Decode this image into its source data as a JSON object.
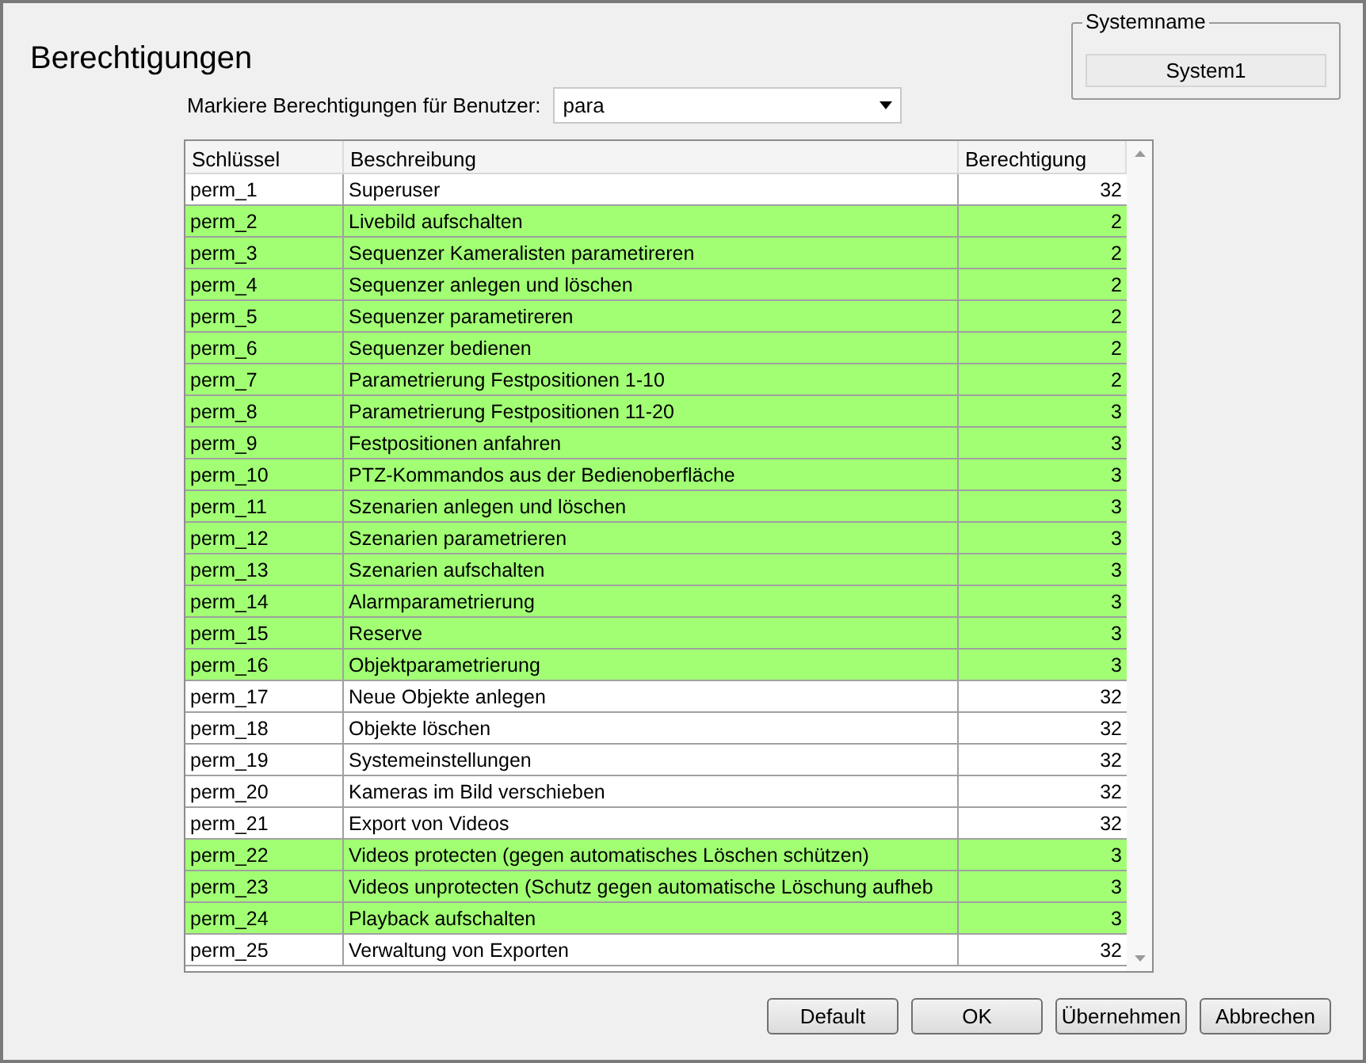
{
  "title": "Berechtigungen",
  "systemname": {
    "legend": "Systemname",
    "value": "System1"
  },
  "user_select": {
    "label": "Markiere Berechtigungen für Benutzer:",
    "value": "para"
  },
  "table": {
    "columns": [
      "Schlüssel",
      "Beschreibung",
      "Berechtigung"
    ],
    "rows": [
      {
        "key": "perm_1",
        "description": "Superuser",
        "permission": "32",
        "marked": false
      },
      {
        "key": "perm_2",
        "description": "Livebild aufschalten",
        "permission": "2",
        "marked": true
      },
      {
        "key": "perm_3",
        "description": "Sequenzer Kameralisten parametireren",
        "permission": "2",
        "marked": true
      },
      {
        "key": "perm_4",
        "description": "Sequenzer anlegen und löschen",
        "permission": "2",
        "marked": true
      },
      {
        "key": "perm_5",
        "description": "Sequenzer parametireren",
        "permission": "2",
        "marked": true
      },
      {
        "key": "perm_6",
        "description": "Sequenzer bedienen",
        "permission": "2",
        "marked": true
      },
      {
        "key": "perm_7",
        "description": "Parametrierung Festpositionen 1-10",
        "permission": "2",
        "marked": true
      },
      {
        "key": "perm_8",
        "description": "Parametrierung Festpositionen 11-20",
        "permission": "3",
        "marked": true
      },
      {
        "key": "perm_9",
        "description": "Festpositionen anfahren",
        "permission": "3",
        "marked": true
      },
      {
        "key": "perm_10",
        "description": "PTZ-Kommandos aus der Bedienoberfläche",
        "permission": "3",
        "marked": true
      },
      {
        "key": "perm_11",
        "description": "Szenarien anlegen und löschen",
        "permission": "3",
        "marked": true
      },
      {
        "key": "perm_12",
        "description": "Szenarien parametrieren",
        "permission": "3",
        "marked": true
      },
      {
        "key": "perm_13",
        "description": "Szenarien aufschalten",
        "permission": "3",
        "marked": true
      },
      {
        "key": "perm_14",
        "description": "Alarmparametrierung",
        "permission": "3",
        "marked": true
      },
      {
        "key": "perm_15",
        "description": "Reserve",
        "permission": "3",
        "marked": true
      },
      {
        "key": "perm_16",
        "description": "Objektparametrierung",
        "permission": "3",
        "marked": true
      },
      {
        "key": "perm_17",
        "description": "Neue Objekte anlegen",
        "permission": "32",
        "marked": false
      },
      {
        "key": "perm_18",
        "description": "Objekte löschen",
        "permission": "32",
        "marked": false
      },
      {
        "key": "perm_19",
        "description": "Systemeinstellungen",
        "permission": "32",
        "marked": false
      },
      {
        "key": "perm_20",
        "description": "Kameras im Bild verschieben",
        "permission": "32",
        "marked": false
      },
      {
        "key": "perm_21",
        "description": "Export von Videos",
        "permission": "32",
        "marked": false
      },
      {
        "key": "perm_22",
        "description": "Videos protecten (gegen automatisches Löschen schützen)",
        "permission": "3",
        "marked": true
      },
      {
        "key": "perm_23",
        "description": "Videos unprotecten (Schutz gegen automatische Löschung aufheb",
        "permission": "3",
        "marked": true
      },
      {
        "key": "perm_24",
        "description": "Playback aufschalten",
        "permission": "3",
        "marked": true
      },
      {
        "key": "perm_25",
        "description": "Verwaltung von Exporten",
        "permission": "32",
        "marked": false
      }
    ]
  },
  "buttons": [
    "Default",
    "OK",
    "Übernehmen",
    "Abbrechen"
  ]
}
